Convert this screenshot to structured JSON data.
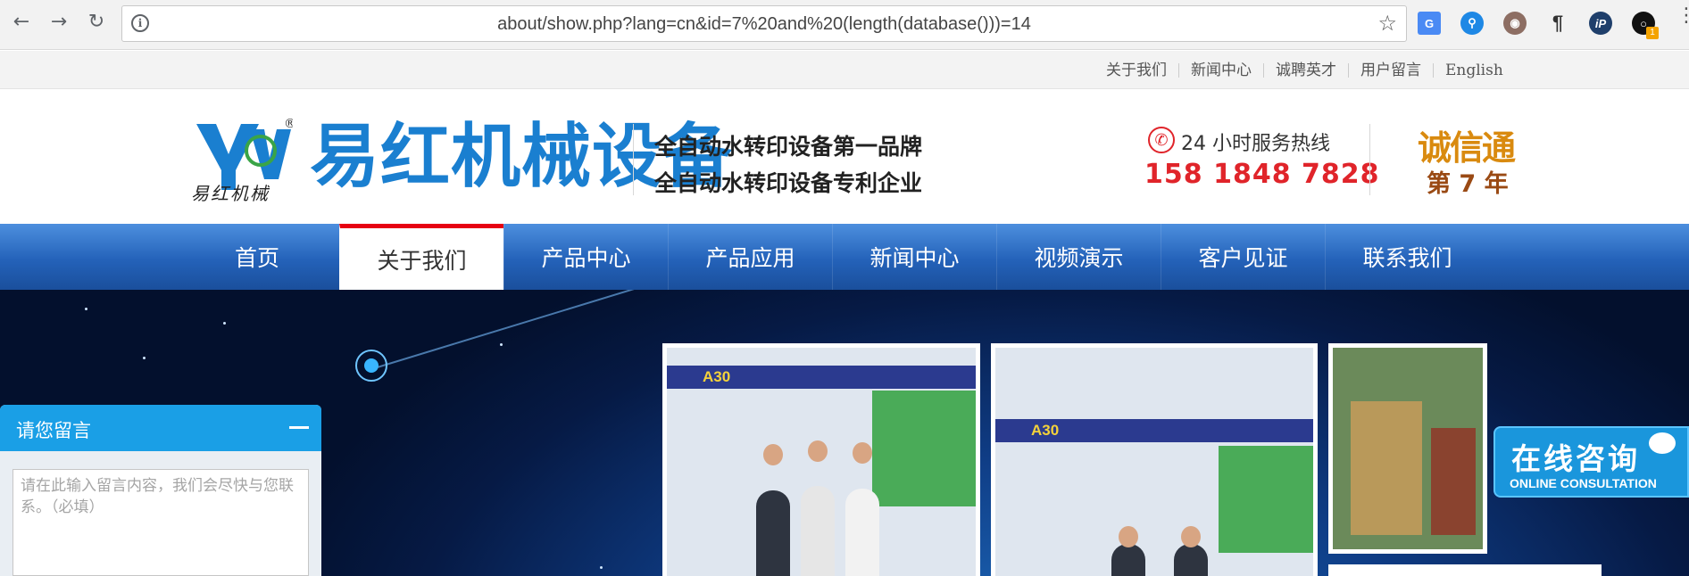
{
  "browser": {
    "url": "about/show.php?lang=cn&id=7%20and%20(length(database()))=14",
    "extensions": [
      "google-translate-icon",
      "key-icon",
      "owl-icon",
      "pilcrow-icon",
      "ip-icon",
      "vpn-icon"
    ],
    "ext_badge": "1"
  },
  "toplinks": [
    "关于我们",
    "新闻中心",
    "诚聘英才",
    "用户留言",
    "English"
  ],
  "header": {
    "logo_sub": "易红机械",
    "brand": "易红机械设备",
    "slogan_1": "全自动水转印设备第一品牌",
    "slogan_2": "全自动水转印设备专利企业",
    "hotline_label": "24 小时服务热线",
    "hotline": "158 1848 7828",
    "cxt": "诚信通",
    "years": "第 7 年"
  },
  "nav": {
    "items": [
      "首页",
      "关于我们",
      "产品中心",
      "产品应用",
      "新闻中心",
      "视频演示",
      "客户见证",
      "联系我们"
    ],
    "active_index": 1
  },
  "banner": {
    "booth_label": "A30"
  },
  "message": {
    "title": "请您留言",
    "placeholder": "请在此输入留言内容，我们会尽快与您联系。（必填）"
  },
  "online": {
    "title": "在线咨询",
    "subtitle": "ONLINE CONSULTATION"
  },
  "colors": {
    "brand_blue": "#1a7fd0",
    "nav_blue": "#2462b9",
    "accent_red": "#e0242a",
    "message_blue": "#1a9fe6"
  }
}
